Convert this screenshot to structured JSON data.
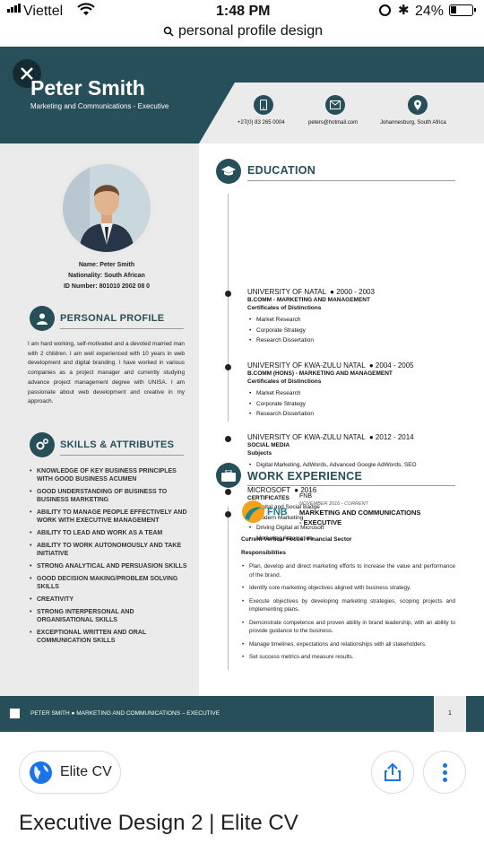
{
  "status": {
    "carrier": "Viettel",
    "time": "1:48 PM",
    "battery": "24%"
  },
  "url": {
    "text": "personal profile design"
  },
  "resume": {
    "name": "Peter Smith",
    "subtitle": "Marketing and Communications - Executive",
    "contacts": [
      {
        "icon": "phone-icon",
        "text": "+27(0) 83 265 0004"
      },
      {
        "icon": "email-icon",
        "text": "peters@hotmail.com"
      },
      {
        "icon": "location-icon",
        "text": "Johannesburg, South Africa"
      }
    ],
    "info": {
      "name": "Name: Peter Smith",
      "nationality": "Nationality: South African",
      "id": "ID Number: 801010 2002 08 0"
    },
    "profile": {
      "title": "PERSONAL PROFILE",
      "text": "I am hard working, self-motivated and a devoted married man with 2 children. I am well experienced with 10 years in web development and digital branding. I have worked in various companies as a project manager and currently studying advance project management degree with UNISA. I am passionate about web development and creative in my approach."
    },
    "skills": {
      "title": "SKILLS & ATTRIBUTES",
      "items": [
        "KNOWLEDGE OF KEY BUSINESS PRINCIPLES WITH GOOD BUSINESS ACUMEN",
        "GOOD UNDERSTANDING OF BUSINESS TO BUSINESS MARKETING",
        "ABILITY TO MANAGE PEOPLE EFFECTIVELY AND WORK WITH EXECUTIVE MANAGEMENT",
        "ABILITY TO LEAD AND WORK AS A TEAM",
        "ABILITY TO WORK AUTONOMOUSLY AND TAKE INITIATIVE",
        "STRONG ANALYTICAL AND PERSUASION SKILLS",
        "GOOD DECISION MAKING/PROBLEM SOLVING SKILLS",
        "CREATIVITY",
        "STRONG INTERPERSONAL AND ORGANISATIONAL SKILLS",
        "EXCEPTIONAL WRITTEN AND ORAL COMMUNICATION SKILLS"
      ]
    },
    "education": {
      "title": "EDUCATION",
      "items": [
        {
          "head": "UNIVERSITY OF NATAL",
          "years": "2000 - 2003",
          "degree": "B.COMM - MARKETING AND MANAGEMENT",
          "sub": "Certificates of Distinctions",
          "bullets": [
            "Market Research",
            "Corporate Strategy",
            "Research Dissertation"
          ]
        },
        {
          "head": "UNIVERSITY OF KWA-ZULU NATAL",
          "years": "2004 - 2005",
          "degree": "B.COMM (HONS) - MARKETING AND MANAGEMENT",
          "sub": "Certificates of Distinctions",
          "bullets": [
            "Market Research",
            "Corporate Strategy",
            "Research Dissertation"
          ]
        },
        {
          "head": "UNIVERSITY OF KWA-ZULU NATAL",
          "years": "2012 - 2014",
          "degree": "SOCIAL MEDIA",
          "sub": "Subjects",
          "bullets": [
            "Digital Marketing, AdWords, Advanced Google AdWords, SEO"
          ]
        },
        {
          "head": "MICROSOFT",
          "years": "2016",
          "degree": "CERTIFICATES",
          "sub": "",
          "bullets": [
            "Digital and Social Badge",
            "Modern Marketing",
            "Driving Digital at Microsoft",
            "Marketing Automation"
          ]
        }
      ]
    },
    "work": {
      "title": "WORK EXPERIENCE",
      "company": "FNB",
      "logo_text": "FNB",
      "dates": "NOVEMBER 2016 - CURRENT",
      "role_line1": "MARKETING AND COMMUNICATIONS",
      "role_line2": "- EXECUTIVE",
      "focus": "Current Vertical Focus:  Financial Sector",
      "resp_title": "Responsibilities",
      "bullets": [
        "Plan, develop and direct marketing efforts to increase the value and performance of the brand.",
        "Identify core marketing objectives aligned with business strategy.",
        "Execute objectives by developing marketing strategies, scoping projects and implementing plans.",
        "Demonstrate competence and proven ability in brand leadership, with an ability to provide guidance to the business.",
        "Manage timelines, expectations and relationships with all stakeholders.",
        "Set success metrics and measure results."
      ]
    },
    "footer": {
      "text": "PETER SMITH  ●  MARKETING AND COMMUNICATIONS – EXECUTIVE",
      "page": "1"
    }
  },
  "bottom": {
    "source": "Elite CV",
    "title": "Executive Design 2 | Elite CV"
  },
  "colors": {
    "teal": "#264f59",
    "gray": "#ebebeb",
    "globe": "#1a73e8",
    "share": "#1a73e8"
  }
}
